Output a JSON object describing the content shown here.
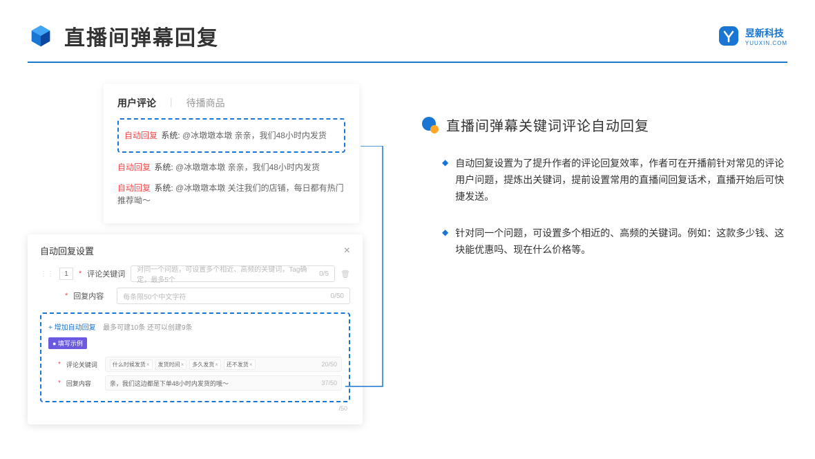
{
  "header": {
    "title": "直播间弹幕回复",
    "brand_name": "昱新科技",
    "brand_url": "YUUXIN.COM"
  },
  "card1": {
    "tab1": "用户评论",
    "tab2": "待播商品",
    "highlighted": {
      "tag": "自动回复",
      "sys": "系统:",
      "text": "@冰墩墩本墩 亲亲，我们48小时内发货"
    },
    "c2": {
      "tag": "自动回复",
      "sys": "系统:",
      "text": "@冰墩墩本墩 亲亲，我们48小时内发货"
    },
    "c3": {
      "tag": "自动回复",
      "sys": "系统:",
      "text": "@冰墩墩本墩 关注我们的店铺，每日都有热门推荐呦～"
    }
  },
  "card2": {
    "title": "自动回复设置",
    "index": "1",
    "row1": {
      "label": "评论关键词",
      "placeholder": "对同一个问题，可设置多个相近、高频的关键词，Tag确定，最多5个",
      "count": "0/5"
    },
    "row2": {
      "label": "回复内容",
      "placeholder": "每条限50个中文字符",
      "count": "0/50"
    },
    "add_link": "+ 增加自动回复",
    "add_hint": "最多可建10条 还可以创建9条",
    "badge": "● 填写示例",
    "sample1": {
      "label": "评论关键词",
      "chips": [
        "什么时候发货",
        "发货时间",
        "多久发货",
        "还不发货"
      ],
      "count": "20/50"
    },
    "sample2": {
      "label": "回复内容",
      "text": "亲，我们这边都是下单48小时内发货的哦～",
      "count": "37/50"
    },
    "bottom_count": "/50"
  },
  "right": {
    "section_title": "直播间弹幕关键词评论自动回复",
    "b1": "自动回复设置为了提升作者的评论回复效率，作者可在开播前针对常见的评论用户问题，提炼出关键词，提前设置常用的直播间回复话术，直播开始后可快捷发送。",
    "b2": "针对同一个问题，可设置多个相近的、高频的关键词。例如：这款多少钱、这块能优惠吗、现在什么价格等。"
  }
}
